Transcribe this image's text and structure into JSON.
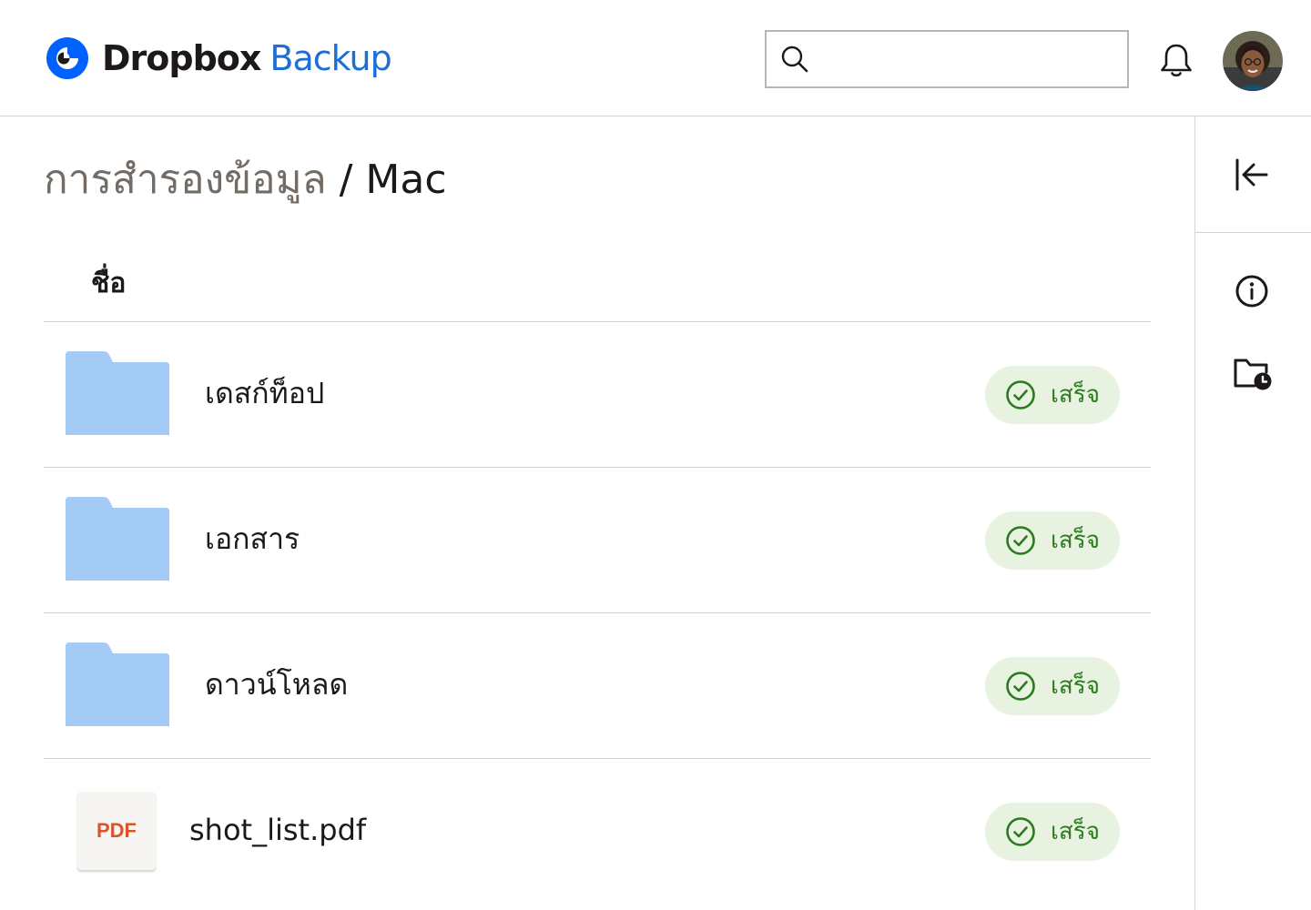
{
  "header": {
    "brand_primary": "Dropbox",
    "brand_secondary": "Backup",
    "search": {
      "value": "",
      "placeholder": ""
    }
  },
  "colors": {
    "brand_blue": "#0061fe",
    "secondary_blue": "#1f6ed4",
    "folder_blue": "#a3cbf5",
    "status_green_bg": "#e8f2e1",
    "status_green_fg": "#2c7a1f",
    "pdf_red": "#d8542b",
    "text_dark": "#1e1919",
    "text_muted": "#736c64",
    "divider": "#d6d3d0"
  },
  "breadcrumb": {
    "parent": "การสำรองข้อมูล",
    "separator": "/",
    "current": "Mac"
  },
  "table": {
    "column_name": "ชื่อ",
    "rows": [
      {
        "name": "เดสก์ท็อป",
        "type": "folder",
        "status": "เสร็จ"
      },
      {
        "name": "เอกสาร",
        "type": "folder",
        "status": "เสร็จ"
      },
      {
        "name": "ดาวน์โหลด",
        "type": "folder",
        "status": "เสร็จ"
      },
      {
        "name": "shot_list.pdf",
        "type": "file",
        "file_badge": "PDF",
        "status": "เสร็จ"
      }
    ]
  },
  "rail": {
    "icons": [
      "collapse-panel-icon",
      "info-icon",
      "folder-history-icon"
    ]
  }
}
